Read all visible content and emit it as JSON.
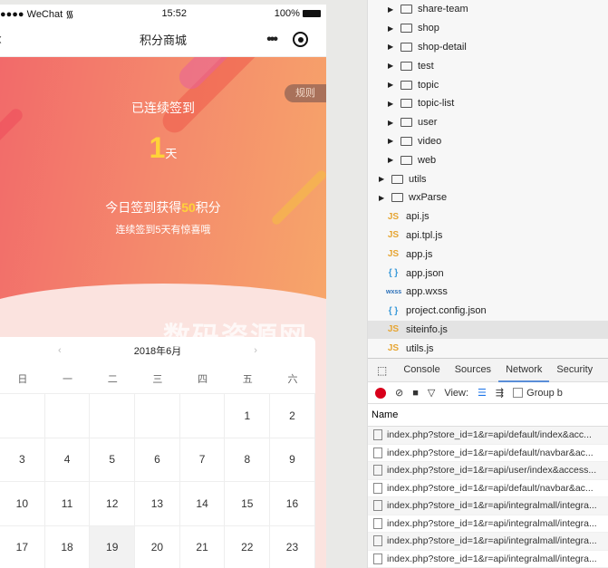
{
  "phone": {
    "status": {
      "carrier": "●●●● WeChat",
      "wifi_icon": "wifi-icon",
      "time": "15:52",
      "battery": "100%"
    },
    "nav": {
      "back": "‹",
      "title": "积分商城",
      "more": "•••"
    },
    "banner": {
      "rules": "规则",
      "consecutive_label": "已连续签到",
      "days": "1",
      "days_unit": "天",
      "today_prefix": "今日签到获得",
      "points": "50",
      "today_suffix": "积分",
      "bonus_hint": "连续签到5天有惊喜哦",
      "colors": {
        "accent": "#ffd23a",
        "start": "#f26a6a",
        "end": "#f7a66a"
      }
    },
    "watermark": "数码资源网",
    "calendar": {
      "month": "2018年6月",
      "prev": "‹",
      "next": "›",
      "weekdays": [
        "日",
        "一",
        "二",
        "三",
        "四",
        "五",
        "六"
      ],
      "days": [
        "",
        "",
        "",
        "",
        "",
        "1",
        "2",
        "3",
        "4",
        "5",
        "6",
        "7",
        "8",
        "9",
        "10",
        "11",
        "12",
        "13",
        "14",
        "15",
        "16",
        "17",
        "18",
        "19",
        "20",
        "21",
        "22",
        "23"
      ],
      "selected": "19"
    }
  },
  "tree": {
    "items": [
      {
        "type": "folder",
        "name": "share-team",
        "level": 2
      },
      {
        "type": "folder",
        "name": "shop",
        "level": 2
      },
      {
        "type": "folder",
        "name": "shop-detail",
        "level": 2
      },
      {
        "type": "folder",
        "name": "test",
        "level": 2
      },
      {
        "type": "folder",
        "name": "topic",
        "level": 2
      },
      {
        "type": "folder",
        "name": "topic-list",
        "level": 2
      },
      {
        "type": "folder",
        "name": "user",
        "level": 2
      },
      {
        "type": "folder",
        "name": "video",
        "level": 2
      },
      {
        "type": "folder",
        "name": "web",
        "level": 2
      },
      {
        "type": "folder",
        "name": "utils",
        "level": 1
      },
      {
        "type": "folder",
        "name": "wxParse",
        "level": 1
      },
      {
        "type": "js",
        "icon": "JS",
        "name": "api.js"
      },
      {
        "type": "js",
        "icon": "JS",
        "name": "api.tpl.js"
      },
      {
        "type": "js",
        "icon": "JS",
        "name": "app.js"
      },
      {
        "type": "json",
        "icon": "{ }",
        "name": "app.json"
      },
      {
        "type": "wxss",
        "icon": "wxss",
        "name": "app.wxss"
      },
      {
        "type": "json",
        "icon": "{ }",
        "name": "project.config.json"
      },
      {
        "type": "js",
        "icon": "JS",
        "name": "siteinfo.js",
        "selected": true
      },
      {
        "type": "js",
        "icon": "JS",
        "name": "utils.js"
      }
    ]
  },
  "devtools": {
    "tabs": [
      "Console",
      "Sources",
      "Network",
      "Security"
    ],
    "active_tab": "Network",
    "view_label": "View:",
    "group_label": "Group b",
    "name_header": "Name",
    "requests": [
      "index.php?store_id=1&r=api/default/index&acc...",
      "index.php?store_id=1&r=api/default/navbar&ac...",
      "index.php?store_id=1&r=api/user/index&access...",
      "index.php?store_id=1&r=api/default/navbar&ac...",
      "index.php?store_id=1&r=api/integralmall/integra...",
      "index.php?store_id=1&r=api/integralmall/integra...",
      "index.php?store_id=1&r=api/integralmall/integra...",
      "index.php?store_id=1&r=api/integralmall/integra..."
    ]
  }
}
